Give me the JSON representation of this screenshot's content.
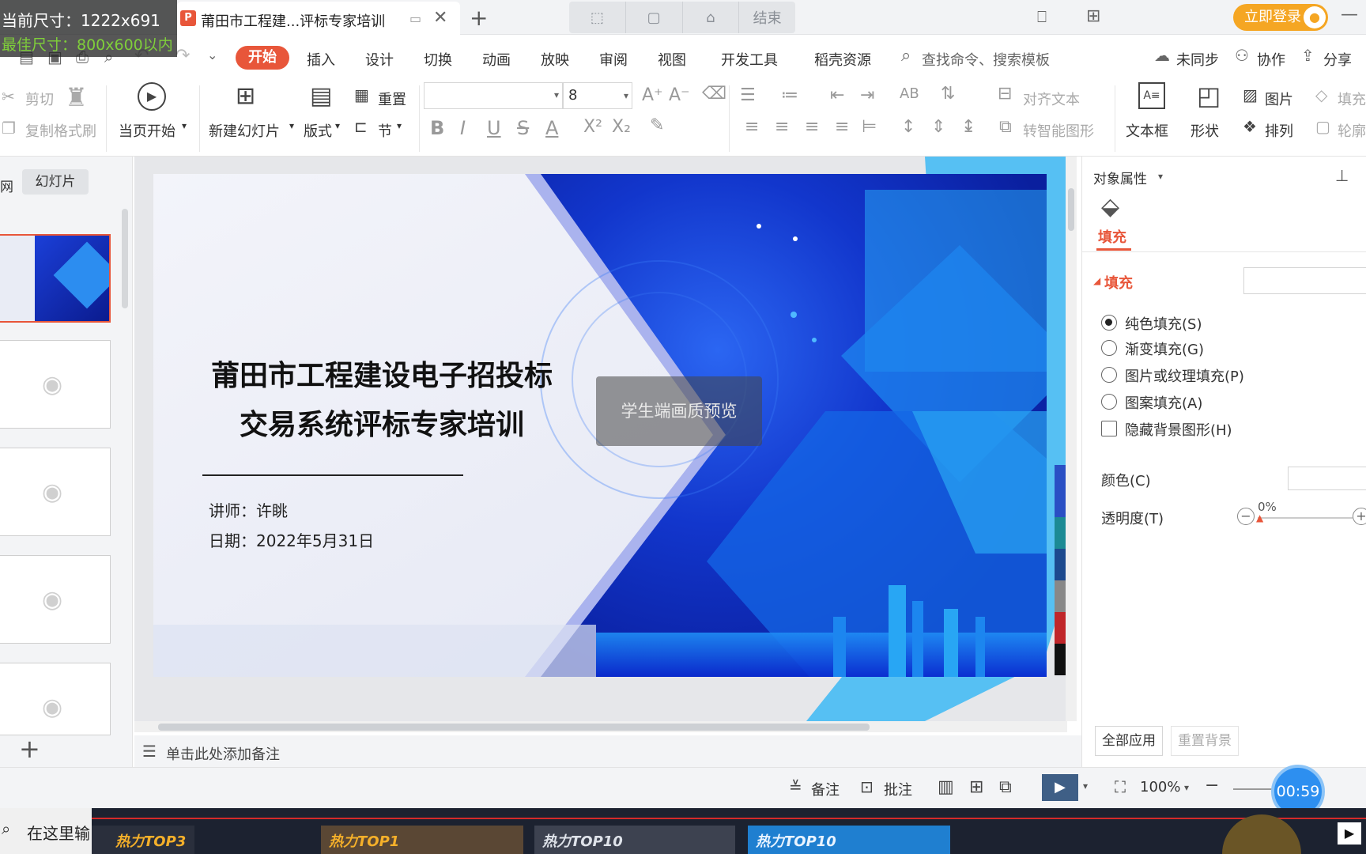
{
  "overlay": {
    "current_size": "当前尺寸：1222x691",
    "best_size": "最佳尺寸：800x600以内"
  },
  "titlebar": {
    "doc_tab_icon": "P",
    "doc_tab_title": "莆田市工程建...评标专家培训",
    "new_tab": "+",
    "slideshow_end": "结束",
    "login": "立即登录"
  },
  "menu": {
    "items": [
      "开始",
      "插入",
      "设计",
      "切换",
      "动画",
      "放映",
      "审阅",
      "视图",
      "开发工具",
      "稻壳资源"
    ],
    "search_placeholder": "查找命令、搜索模板",
    "sync": "未同步",
    "collab": "协作",
    "share": "分享"
  },
  "ribbon": {
    "cut": "剪切",
    "copy": "复制",
    "format_painter": "格式刷",
    "start_from_current": "当页开始",
    "new_slide": "新建幻灯片",
    "layout": "版式",
    "reset": "重置",
    "section": "节",
    "font_size": "8",
    "align_text": "对齐文本",
    "smart_shape": "转智能图形",
    "textbox": "文本框",
    "shape": "形状",
    "picture": "图片",
    "arrange": "排列",
    "fill": "填充",
    "outline": "轮廓"
  },
  "leftpanel": {
    "tab_outline": "网",
    "tab_slides": "幻灯片",
    "add": "+"
  },
  "slide": {
    "title_line1": "莆田市工程建设电子招投标",
    "title_line2": "交易系统评标专家培训",
    "lecturer": "讲师：许眺",
    "date": "日期：2022年5月31日",
    "preview_badge": "学生端画质预览"
  },
  "notes": {
    "placeholder": "单击此处添加备注"
  },
  "rightpane": {
    "header": "对象属性",
    "fill_tab": "填充",
    "fill_section": "填充",
    "options": [
      "纯色填充(S)",
      "渐变填充(G)",
      "图片或纹理填充(P)",
      "图案填充(A)"
    ],
    "hide_bg": "隐藏背景图形(H)",
    "color_label": "颜色(C)",
    "transparency_label": "透明度(T)",
    "transparency_value": "0%",
    "apply_all": "全部应用",
    "reset_bg": "重置背景"
  },
  "statusbar": {
    "notes": "备注",
    "comment": "批注",
    "zoom": "100%",
    "timer": "00:59"
  },
  "taskstrip": {
    "search": "在这里输",
    "videos": [
      "热力TOP3",
      "热力TOP1",
      "热力TOP10",
      "热力TOP10"
    ]
  }
}
